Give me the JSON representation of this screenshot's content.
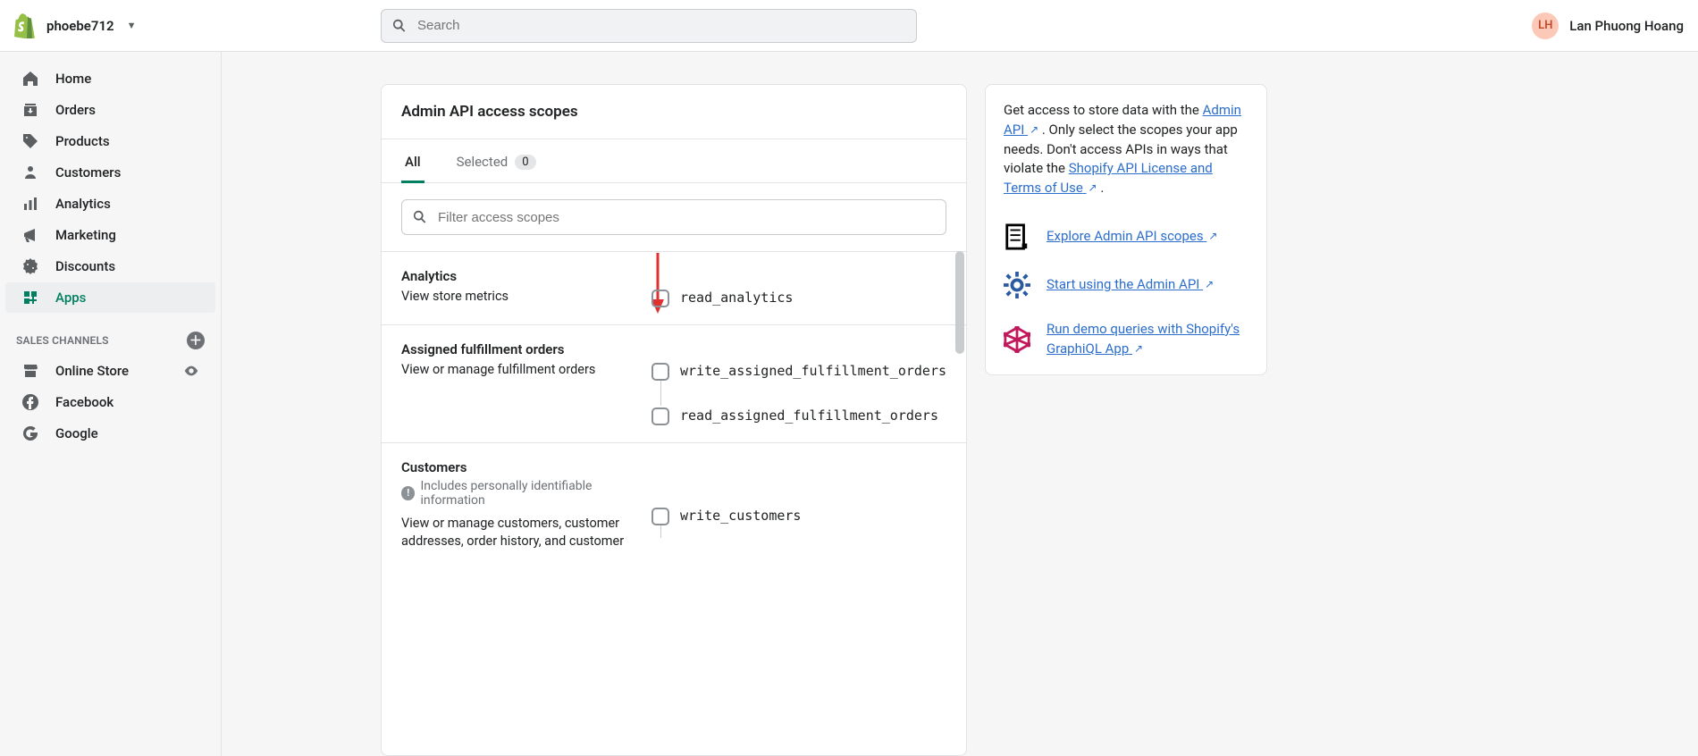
{
  "header": {
    "store_name": "phoebe712",
    "search_placeholder": "Search",
    "user_initials": "LH",
    "user_name": "Lan Phuong Hoang"
  },
  "sidebar": {
    "items": [
      {
        "label": "Home"
      },
      {
        "label": "Orders"
      },
      {
        "label": "Products"
      },
      {
        "label": "Customers"
      },
      {
        "label": "Analytics"
      },
      {
        "label": "Marketing"
      },
      {
        "label": "Discounts"
      },
      {
        "label": "Apps"
      }
    ],
    "section_label": "SALES CHANNELS",
    "channels": [
      {
        "label": "Online Store"
      },
      {
        "label": "Facebook"
      },
      {
        "label": "Google"
      }
    ]
  },
  "main": {
    "title": "Admin API access scopes",
    "tabs": {
      "all": "All",
      "selected": "Selected",
      "selected_count": "0"
    },
    "filter_placeholder": "Filter access scopes",
    "groups": [
      {
        "title": "Analytics",
        "desc": "View store metrics",
        "scopes": [
          {
            "name": "read_analytics"
          }
        ]
      },
      {
        "title": "Assigned fulfillment orders",
        "desc": "View or manage fulfillment orders",
        "scopes": [
          {
            "name": "write_assigned_fulfillment_orders"
          },
          {
            "name": "read_assigned_fulfillment_orders"
          }
        ]
      },
      {
        "title": "Customers",
        "pii": "Includes personally identifiable information",
        "desc": "View or manage customers, customer addresses, order history, and customer",
        "scopes": [
          {
            "name": "write_customers"
          }
        ]
      }
    ]
  },
  "side": {
    "intro_1": "Get access to store data with the ",
    "link_admin": "Admin API",
    "intro_2": " . Only select the scopes your app needs. Don't access APIs in ways that violate the ",
    "link_license": "Shopify API License and Terms of Use",
    "intro_3": " .",
    "links": [
      {
        "label": "Explore Admin API scopes"
      },
      {
        "label": "Start using the Admin API"
      },
      {
        "label": "Run demo queries with Shopify's GraphiQL App"
      }
    ]
  }
}
